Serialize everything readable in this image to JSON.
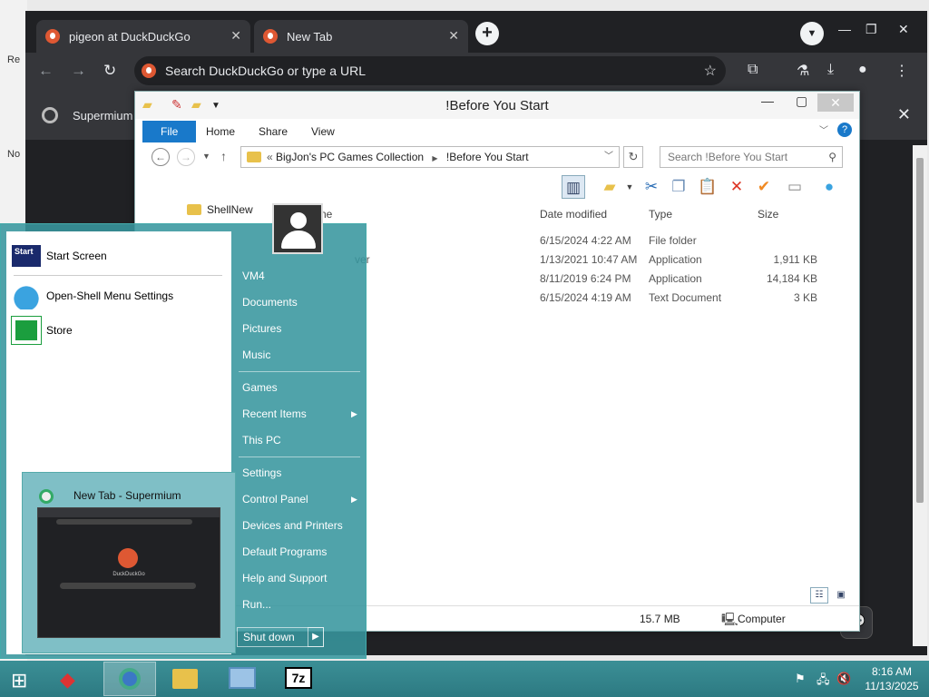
{
  "browser": {
    "tabs": [
      {
        "label": "pigeon at DuckDuckGo"
      },
      {
        "label": "New Tab"
      }
    ],
    "omnibox_placeholder": "Search DuckDuckGo or type a URL",
    "infobar_title": "Supermium"
  },
  "explorer": {
    "title": "!Before You Start",
    "ribbon_tabs": [
      "File",
      "Home",
      "Share",
      "View"
    ],
    "breadcrumb": [
      "BigJon's PC Games Collection",
      "!Before You Start"
    ],
    "search_placeholder": "Search !Before You Start",
    "columns": [
      "Date modified",
      "Type",
      "Size"
    ],
    "partial_name_header": "ne",
    "rows": [
      {
        "date": "6/15/2024 4:22 AM",
        "type": "File folder",
        "size": ""
      },
      {
        "name_fragment": "ver",
        "date": "1/13/2021 10:47 AM",
        "type": "Application",
        "size": "1,911 KB"
      },
      {
        "date": "8/11/2019 6:24 PM",
        "type": "Application",
        "size": "14,184 KB"
      },
      {
        "date": "6/15/2024 4:19 AM",
        "type": "Text Document",
        "size": "3 KB"
      }
    ],
    "shellnew_label": "ShellNew",
    "status_size": "15.7 MB",
    "status_location": "Computer"
  },
  "startmenu": {
    "left_items": [
      {
        "label": "Start Screen"
      },
      {
        "label": "Open-Shell Menu Settings"
      },
      {
        "label": "Store"
      }
    ],
    "right_items": [
      {
        "label": "VM4"
      },
      {
        "label": "Documents"
      },
      {
        "label": "Pictures"
      },
      {
        "label": "Music"
      },
      {
        "label": "Games"
      },
      {
        "label": "Recent Items"
      },
      {
        "label": "This PC"
      },
      {
        "label": "Settings"
      },
      {
        "label": "Control Panel"
      },
      {
        "label": "Devices and Printers"
      },
      {
        "label": "Default Programs"
      },
      {
        "label": "Help and Support"
      },
      {
        "label": "Run..."
      }
    ],
    "shutdown_label": "Shut down",
    "start_tile_label": "Start"
  },
  "thumbnail": {
    "title": "New Tab - Supermium",
    "page_label": "DuckDuckGo"
  },
  "taskbar": {
    "time": "8:16 AM",
    "date": "11/13/2025",
    "app_7z": "7z"
  },
  "desktop": {
    "edge_texts": [
      "Re",
      "No"
    ]
  },
  "colors": {
    "accent": "#1979ca",
    "startmenu": "#38969e",
    "duckduckgo": "#de5833",
    "taskbar": "#2d7a82"
  }
}
